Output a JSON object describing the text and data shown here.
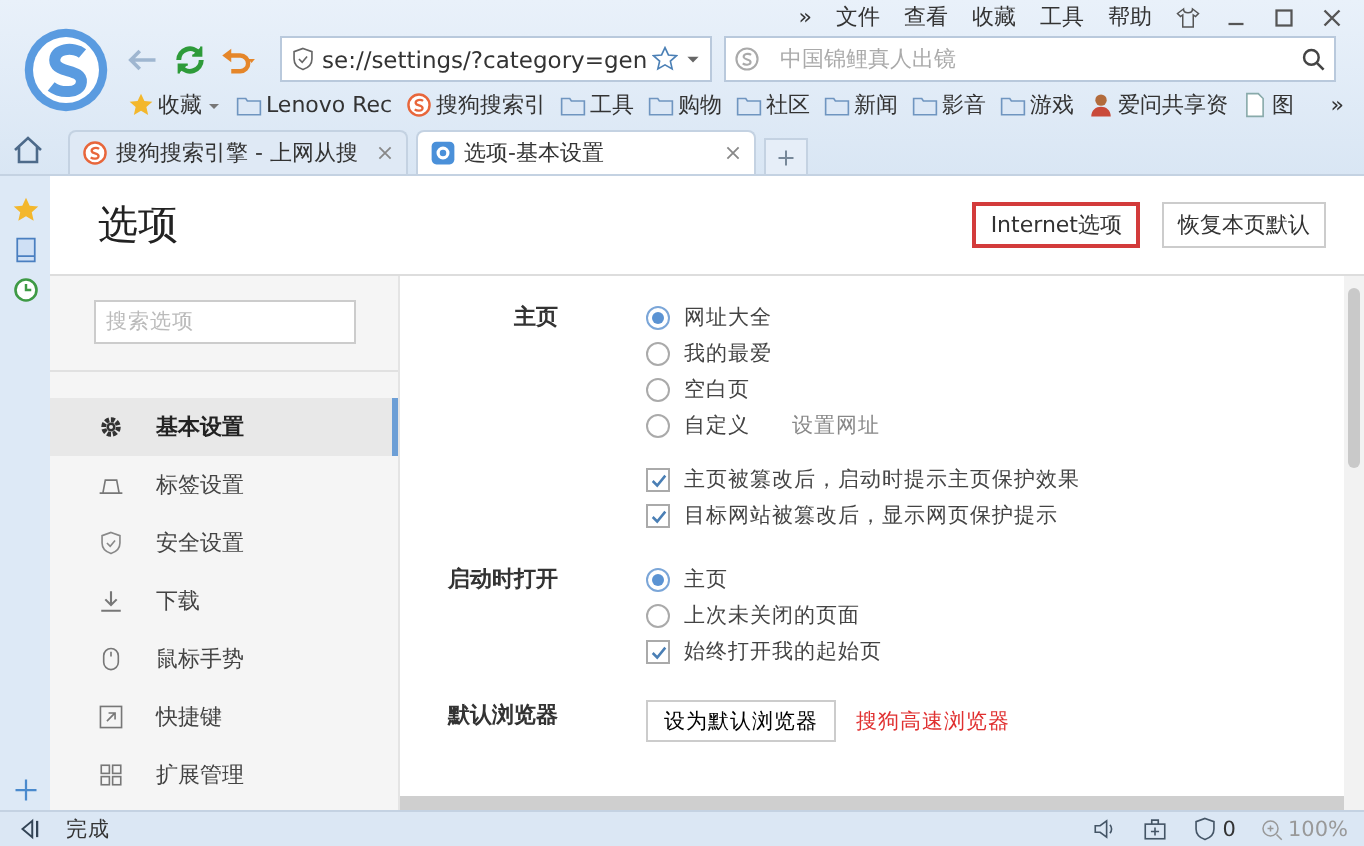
{
  "menu_bar": {
    "overflow": "»",
    "items": [
      "文件",
      "查看",
      "收藏",
      "工具",
      "帮助"
    ]
  },
  "toolbar": {
    "address": "se://settings/?category=gen",
    "search_placeholder": "中国锦鲤真人出镜"
  },
  "bookmarks": {
    "overflow": "»",
    "items": [
      {
        "label": "收藏",
        "kind": "favorites"
      },
      {
        "label": "Lenovo Rec",
        "kind": "folder"
      },
      {
        "label": "搜狗搜索引",
        "kind": "sogou"
      },
      {
        "label": "工具",
        "kind": "folder"
      },
      {
        "label": "购物",
        "kind": "folder"
      },
      {
        "label": "社区",
        "kind": "folder"
      },
      {
        "label": "新闻",
        "kind": "folder"
      },
      {
        "label": "影音",
        "kind": "folder"
      },
      {
        "label": "游戏",
        "kind": "folder"
      },
      {
        "label": "爱问共享资",
        "kind": "person"
      },
      {
        "label": "图",
        "kind": "page"
      }
    ]
  },
  "tabs": [
    {
      "label": "搜狗搜索引擎 - 上网从搜",
      "kind": "sogou",
      "selected": false
    },
    {
      "label": "选项-基本设置",
      "kind": "settings",
      "selected": true
    }
  ],
  "page": {
    "title": "选项",
    "buttons": [
      {
        "label": "Internet选项",
        "highlighted": true
      },
      {
        "label": "恢复本页默认",
        "highlighted": false
      }
    ]
  },
  "nav": {
    "search_placeholder": "搜索选项",
    "items": [
      {
        "label": "基本设置",
        "selected": true
      },
      {
        "label": "标签设置",
        "selected": false
      },
      {
        "label": "安全设置",
        "selected": false
      },
      {
        "label": "下载",
        "selected": false
      },
      {
        "label": "鼠标手势",
        "selected": false
      },
      {
        "label": "快捷键",
        "selected": false
      },
      {
        "label": "扩展管理",
        "selected": false
      }
    ]
  },
  "sections": [
    {
      "label": "主页",
      "groups": [
        [
          {
            "kind": "radio",
            "label": "网址大全",
            "selected": true
          },
          {
            "kind": "radio",
            "label": "我的最爱",
            "selected": false
          },
          {
            "kind": "radio",
            "label": "空白页",
            "selected": false
          },
          {
            "kind": "radio",
            "label": "自定义",
            "selected": false,
            "link": "设置网址"
          }
        ],
        [
          {
            "kind": "checkbox",
            "label": "主页被篡改后，启动时提示主页保护效果",
            "checked": true
          },
          {
            "kind": "checkbox",
            "label": "目标网站被篡改后，显示网页保护提示",
            "checked": true
          }
        ]
      ]
    },
    {
      "label": "启动时打开",
      "groups": [
        [
          {
            "kind": "radio",
            "label": "主页",
            "selected": true
          },
          {
            "kind": "radio",
            "label": "上次未关闭的页面",
            "selected": false
          },
          {
            "kind": "checkbox",
            "label": "始终打开我的起始页",
            "checked": true
          }
        ]
      ]
    },
    {
      "label": "默认浏览器",
      "button": "设为默认浏览器",
      "note": "搜狗高速浏览器"
    }
  ],
  "status_bar": {
    "text": "完成",
    "blocked_count": "0",
    "zoom": "100%"
  }
}
